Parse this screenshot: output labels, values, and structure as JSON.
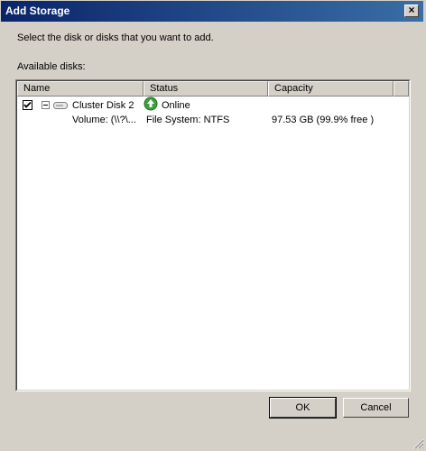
{
  "window": {
    "title": "Add Storage",
    "close_glyph": "×"
  },
  "instruction": "Select the disk or disks that you want to add.",
  "available_label": "Available disks:",
  "columns": {
    "name": "Name",
    "status": "Status",
    "capacity": "Capacity"
  },
  "rows": [
    {
      "name": "Cluster Disk 2",
      "status": "Online",
      "capacity": "",
      "checked": true,
      "expanded": true,
      "icon": "disk-icon",
      "status_icon": "online-arrow-icon"
    },
    {
      "name": "Volume: (\\\\?\\...",
      "status": "File System: NTFS",
      "capacity": "97.53 GB (99.9% free )"
    }
  ],
  "buttons": {
    "ok": "OK",
    "cancel": "Cancel"
  },
  "colors": {
    "titlebar_start": "#0a246a",
    "titlebar_end": "#3a6ea5",
    "online_green": "#3aa23a"
  }
}
